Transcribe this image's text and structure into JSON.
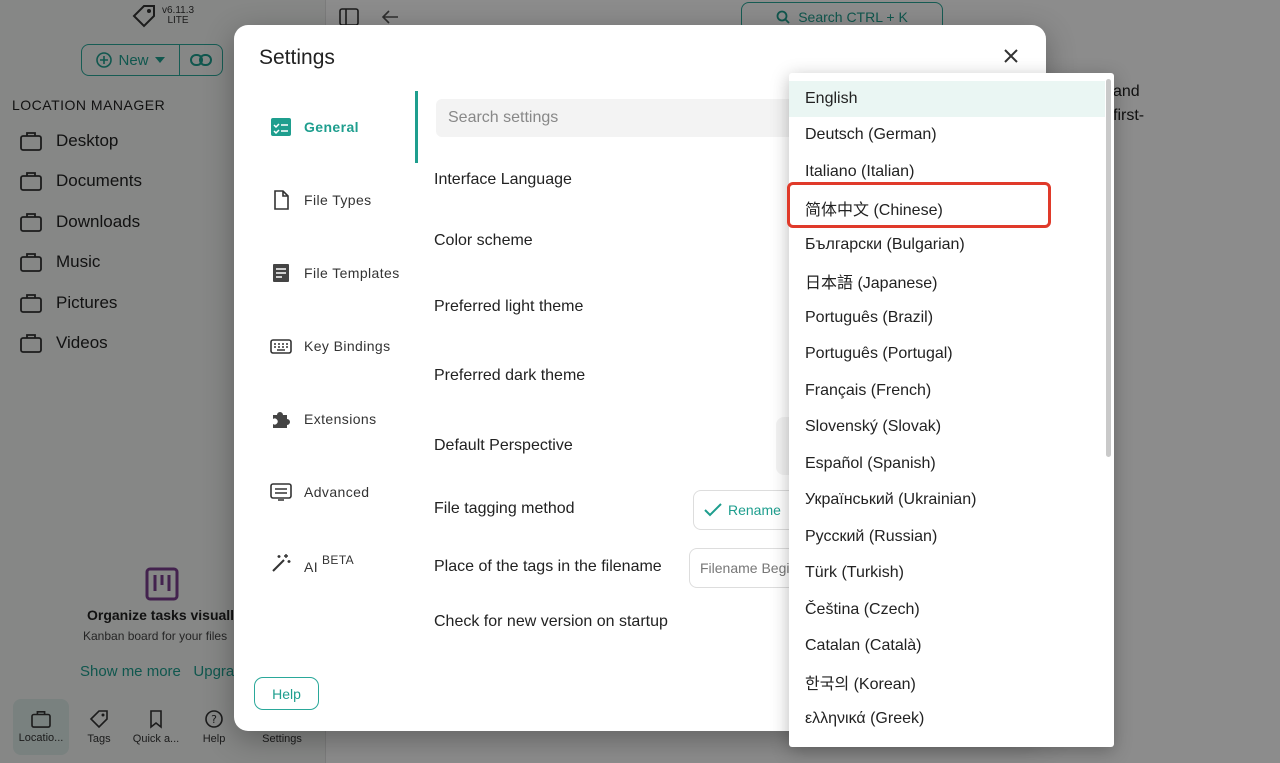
{
  "app": {
    "version": "v6.11.3",
    "edition": "LITE",
    "new_label": "New",
    "location_manager_label": "LOCATION MANAGER",
    "locations": [
      "Desktop",
      "Documents",
      "Downloads",
      "Music",
      "Pictures",
      "Videos"
    ],
    "search_label": "Search  CTRL + K",
    "bg_text_line1": "and",
    "bg_text_line2": "first-",
    "promo_title": "Organize tasks visually",
    "promo_subtitle": "Kanban board for your files",
    "promo_link1": "Show me more",
    "promo_link2": "Upgrade",
    "bottom_nav": [
      "Locatio...",
      "Tags",
      "Quick a...",
      "Help",
      "Settings"
    ]
  },
  "settings": {
    "title": "Settings",
    "tabs": [
      {
        "label": "General",
        "icon": "general-icon"
      },
      {
        "label": "File Types",
        "icon": "file-icon"
      },
      {
        "label": "File Templates",
        "icon": "template-icon"
      },
      {
        "label": "Key Bindings",
        "icon": "keyboard-icon"
      },
      {
        "label": "Extensions",
        "icon": "puzzle-icon"
      },
      {
        "label": "Advanced",
        "icon": "advanced-icon"
      },
      {
        "label": "AI",
        "icon": "magic-wand-icon",
        "badge": "BETA"
      }
    ],
    "help_label": "Help",
    "search_placeholder": "Search settings",
    "rows": [
      "Interface Language",
      "Color scheme",
      "Preferred light theme",
      "Preferred dark theme",
      "Default Perspective",
      "File tagging method",
      "Place of the tags in the filename",
      "Check for new version on startup"
    ],
    "tagging_value": "Rename",
    "tags_place_value": "Filename Beginning"
  },
  "language_menu": {
    "selected": "English",
    "highlighted": "简体中文 (Chinese)",
    "highlight_color": "#e03a2a",
    "options": [
      "English",
      "Deutsch (German)",
      "Italiano (Italian)",
      "简体中文 (Chinese)",
      "Български (Bulgarian)",
      "日本語 (Japanese)",
      "Português (Brazil)",
      "Português (Portugal)",
      "Français (French)",
      "Slovenský (Slovak)",
      "Español (Spanish)",
      "Український (Ukrainian)",
      "Русский (Russian)",
      "Türk (Turkish)",
      "Čeština (Czech)",
      "Catalan (Català)",
      "한국의 (Korean)",
      "ελληνικά (Greek)"
    ]
  },
  "colors": {
    "accent": "#1e9e8e"
  }
}
